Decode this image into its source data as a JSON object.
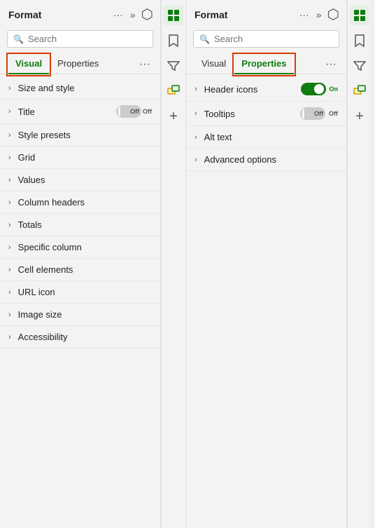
{
  "left_panel": {
    "title": "Format",
    "search_placeholder": "Search",
    "tabs": [
      {
        "id": "visual",
        "label": "Visual",
        "active": true
      },
      {
        "id": "properties",
        "label": "Properties",
        "active": false
      }
    ],
    "menu_items": [
      {
        "id": "size-and-style",
        "label": "Size and style",
        "toggle": null
      },
      {
        "id": "title",
        "label": "Title",
        "toggle": "off"
      },
      {
        "id": "style-presets",
        "label": "Style presets",
        "toggle": null
      },
      {
        "id": "grid",
        "label": "Grid",
        "toggle": null
      },
      {
        "id": "values",
        "label": "Values",
        "toggle": null
      },
      {
        "id": "column-headers",
        "label": "Column headers",
        "toggle": null
      },
      {
        "id": "totals",
        "label": "Totals",
        "toggle": null
      },
      {
        "id": "specific-column",
        "label": "Specific column",
        "toggle": null
      },
      {
        "id": "cell-elements",
        "label": "Cell elements",
        "toggle": null
      },
      {
        "id": "url-icon",
        "label": "URL icon",
        "toggle": null
      },
      {
        "id": "image-size",
        "label": "Image size",
        "toggle": null
      },
      {
        "id": "accessibility",
        "label": "Accessibility",
        "toggle": null
      }
    ]
  },
  "right_panel": {
    "title": "Format",
    "search_placeholder": "Search",
    "tabs": [
      {
        "id": "visual",
        "label": "Visual",
        "active": false
      },
      {
        "id": "properties",
        "label": "Properties",
        "active": true
      }
    ],
    "menu_items": [
      {
        "id": "header-icons",
        "label": "Header icons",
        "toggle": "on"
      },
      {
        "id": "tooltips",
        "label": "Tooltips",
        "toggle": "off"
      },
      {
        "id": "alt-text",
        "label": "Alt text",
        "toggle": null
      },
      {
        "id": "advanced-options",
        "label": "Advanced options",
        "toggle": null
      }
    ]
  },
  "side_icons": {
    "icon_groups": [
      {
        "id": "format-visual",
        "symbol": "⬡",
        "active": true
      },
      {
        "id": "bookmark",
        "symbol": "🔖",
        "active": false
      },
      {
        "id": "filter",
        "symbol": "⧖",
        "active": false
      },
      {
        "id": "drillthrough",
        "symbol": "⊞",
        "active": false
      },
      {
        "id": "add",
        "symbol": "+",
        "active": false
      }
    ]
  },
  "icons": {
    "ellipsis": "···",
    "chevron_right": "›",
    "double_chevron": "»",
    "search": "🔍",
    "add": "+"
  }
}
